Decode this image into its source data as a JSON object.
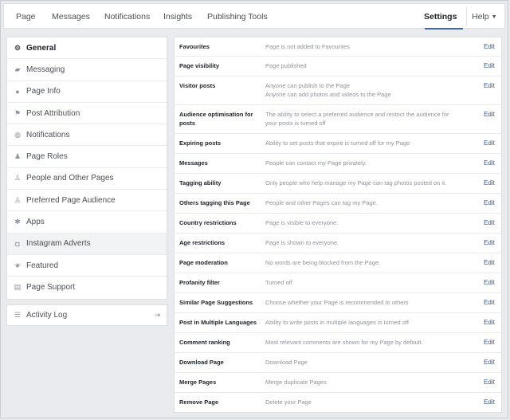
{
  "topnav": {
    "items": [
      "Page",
      "Messages",
      "Notifications",
      "Insights",
      "Publishing Tools"
    ],
    "settings": "Settings",
    "help": "Help"
  },
  "sidebar": {
    "items": [
      {
        "label": "General",
        "icon": "gear-icon"
      },
      {
        "label": "Messaging",
        "icon": "chat-bubbles-icon"
      },
      {
        "label": "Page Info",
        "icon": "location-pin-icon"
      },
      {
        "label": "Post Attribution",
        "icon": "flag-icon"
      },
      {
        "label": "Notifications",
        "icon": "globe-icon"
      },
      {
        "label": "Page Roles",
        "icon": "person-icon"
      },
      {
        "label": "People and Other Pages",
        "icon": "people-icon"
      },
      {
        "label": "Preferred Page Audience",
        "icon": "people-icon"
      },
      {
        "label": "Apps",
        "icon": "apps-icon"
      },
      {
        "label": "Instagram Adverts",
        "icon": "instagram-icon"
      },
      {
        "label": "Featured",
        "icon": "star-icon"
      },
      {
        "label": "Page Support",
        "icon": "support-icon"
      }
    ],
    "activity_log": "Activity Log"
  },
  "settings": {
    "edit_label": "Edit",
    "rows": [
      {
        "name": "Favourites",
        "value": [
          "Page is not added to Favourites"
        ]
      },
      {
        "name": "Page visibility",
        "value": [
          "Page published"
        ]
      },
      {
        "name": "Visitor posts",
        "value": [
          "Anyone can publish to the Page",
          "Anyone can add photos and videos to the Page"
        ]
      },
      {
        "name": "Audience optimisation for posts",
        "value": [
          "The ability to select a preferred audience and restrict the audience for",
          "your posts is turned off"
        ]
      },
      {
        "name": "Expiring posts",
        "value": [
          "Ability to set posts that expire is turned off for my Page"
        ]
      },
      {
        "name": "Messages",
        "value": [
          "People can contact my Page privately."
        ]
      },
      {
        "name": "Tagging ability",
        "value": [
          "Only people who help manage my Page can tag photos posted on it."
        ]
      },
      {
        "name": "Others tagging this Page",
        "value": [
          "People and other Pages can tag my Page."
        ]
      },
      {
        "name": "Country restrictions",
        "value": [
          "Page is visible to everyone."
        ]
      },
      {
        "name": "Age restrictions",
        "value": [
          "Page is shown to everyone."
        ]
      },
      {
        "name": "Page moderation",
        "value": [
          "No words are being blocked from the Page."
        ]
      },
      {
        "name": "Profanity filter",
        "value": [
          "Turned off"
        ]
      },
      {
        "name": "Similar Page Suggestions",
        "value": [
          "Choose whether your Page is recommended to others"
        ]
      },
      {
        "name": "Post in Multiple Languages",
        "value": [
          "Ability to write posts in multiple languages is turned off"
        ]
      },
      {
        "name": "Comment ranking",
        "value": [
          "Most relevant comments are shown for my Page by default."
        ]
      },
      {
        "name": "Download Page",
        "value": [
          "Download Page"
        ]
      },
      {
        "name": "Merge Pages",
        "value": [
          "Merge duplicate Pages"
        ]
      },
      {
        "name": "Remove Page",
        "value": [
          "Delete your Page"
        ]
      }
    ]
  }
}
